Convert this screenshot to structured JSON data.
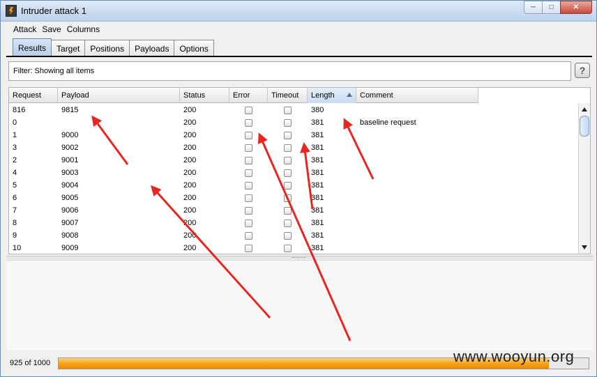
{
  "window": {
    "title": "Intruder attack 1"
  },
  "menu": [
    "Attack",
    "Save",
    "Columns"
  ],
  "tabs": [
    "Results",
    "Target",
    "Positions",
    "Payloads",
    "Options"
  ],
  "active_tab": "Results",
  "filter": {
    "text": "Filter:  Showing all items"
  },
  "help_label": "?",
  "table": {
    "columns": [
      "Request",
      "Payload",
      "Status",
      "Error",
      "Timeout",
      "Length",
      "Comment"
    ],
    "sorted_column": "Length",
    "rows": [
      {
        "request": "816",
        "payload": "9815",
        "status": "200",
        "length": "380",
        "comment": ""
      },
      {
        "request": "0",
        "payload": "",
        "status": "200",
        "length": "381",
        "comment": "baseline request"
      },
      {
        "request": "1",
        "payload": "9000",
        "status": "200",
        "length": "381",
        "comment": ""
      },
      {
        "request": "3",
        "payload": "9002",
        "status": "200",
        "length": "381",
        "comment": ""
      },
      {
        "request": "2",
        "payload": "9001",
        "status": "200",
        "length": "381",
        "comment": ""
      },
      {
        "request": "4",
        "payload": "9003",
        "status": "200",
        "length": "381",
        "comment": ""
      },
      {
        "request": "5",
        "payload": "9004",
        "status": "200",
        "length": "381",
        "comment": ""
      },
      {
        "request": "6",
        "payload": "9005",
        "status": "200",
        "length": "381",
        "comment": ""
      },
      {
        "request": "7",
        "payload": "9006",
        "status": "200",
        "length": "381",
        "comment": ""
      },
      {
        "request": "8",
        "payload": "9007",
        "status": "200",
        "length": "381",
        "comment": ""
      },
      {
        "request": "9",
        "payload": "9008",
        "status": "200",
        "length": "381",
        "comment": ""
      },
      {
        "request": "10",
        "payload": "9009",
        "status": "200",
        "length": "381",
        "comment": ""
      }
    ]
  },
  "status": {
    "progress_text": "925 of 1000",
    "progress_fraction": 0.925
  },
  "watermark": "www.wooyun.org",
  "colors": {
    "arrow": "#e8251f",
    "progress": "#f7a21b",
    "accent": "#b8cde6"
  }
}
